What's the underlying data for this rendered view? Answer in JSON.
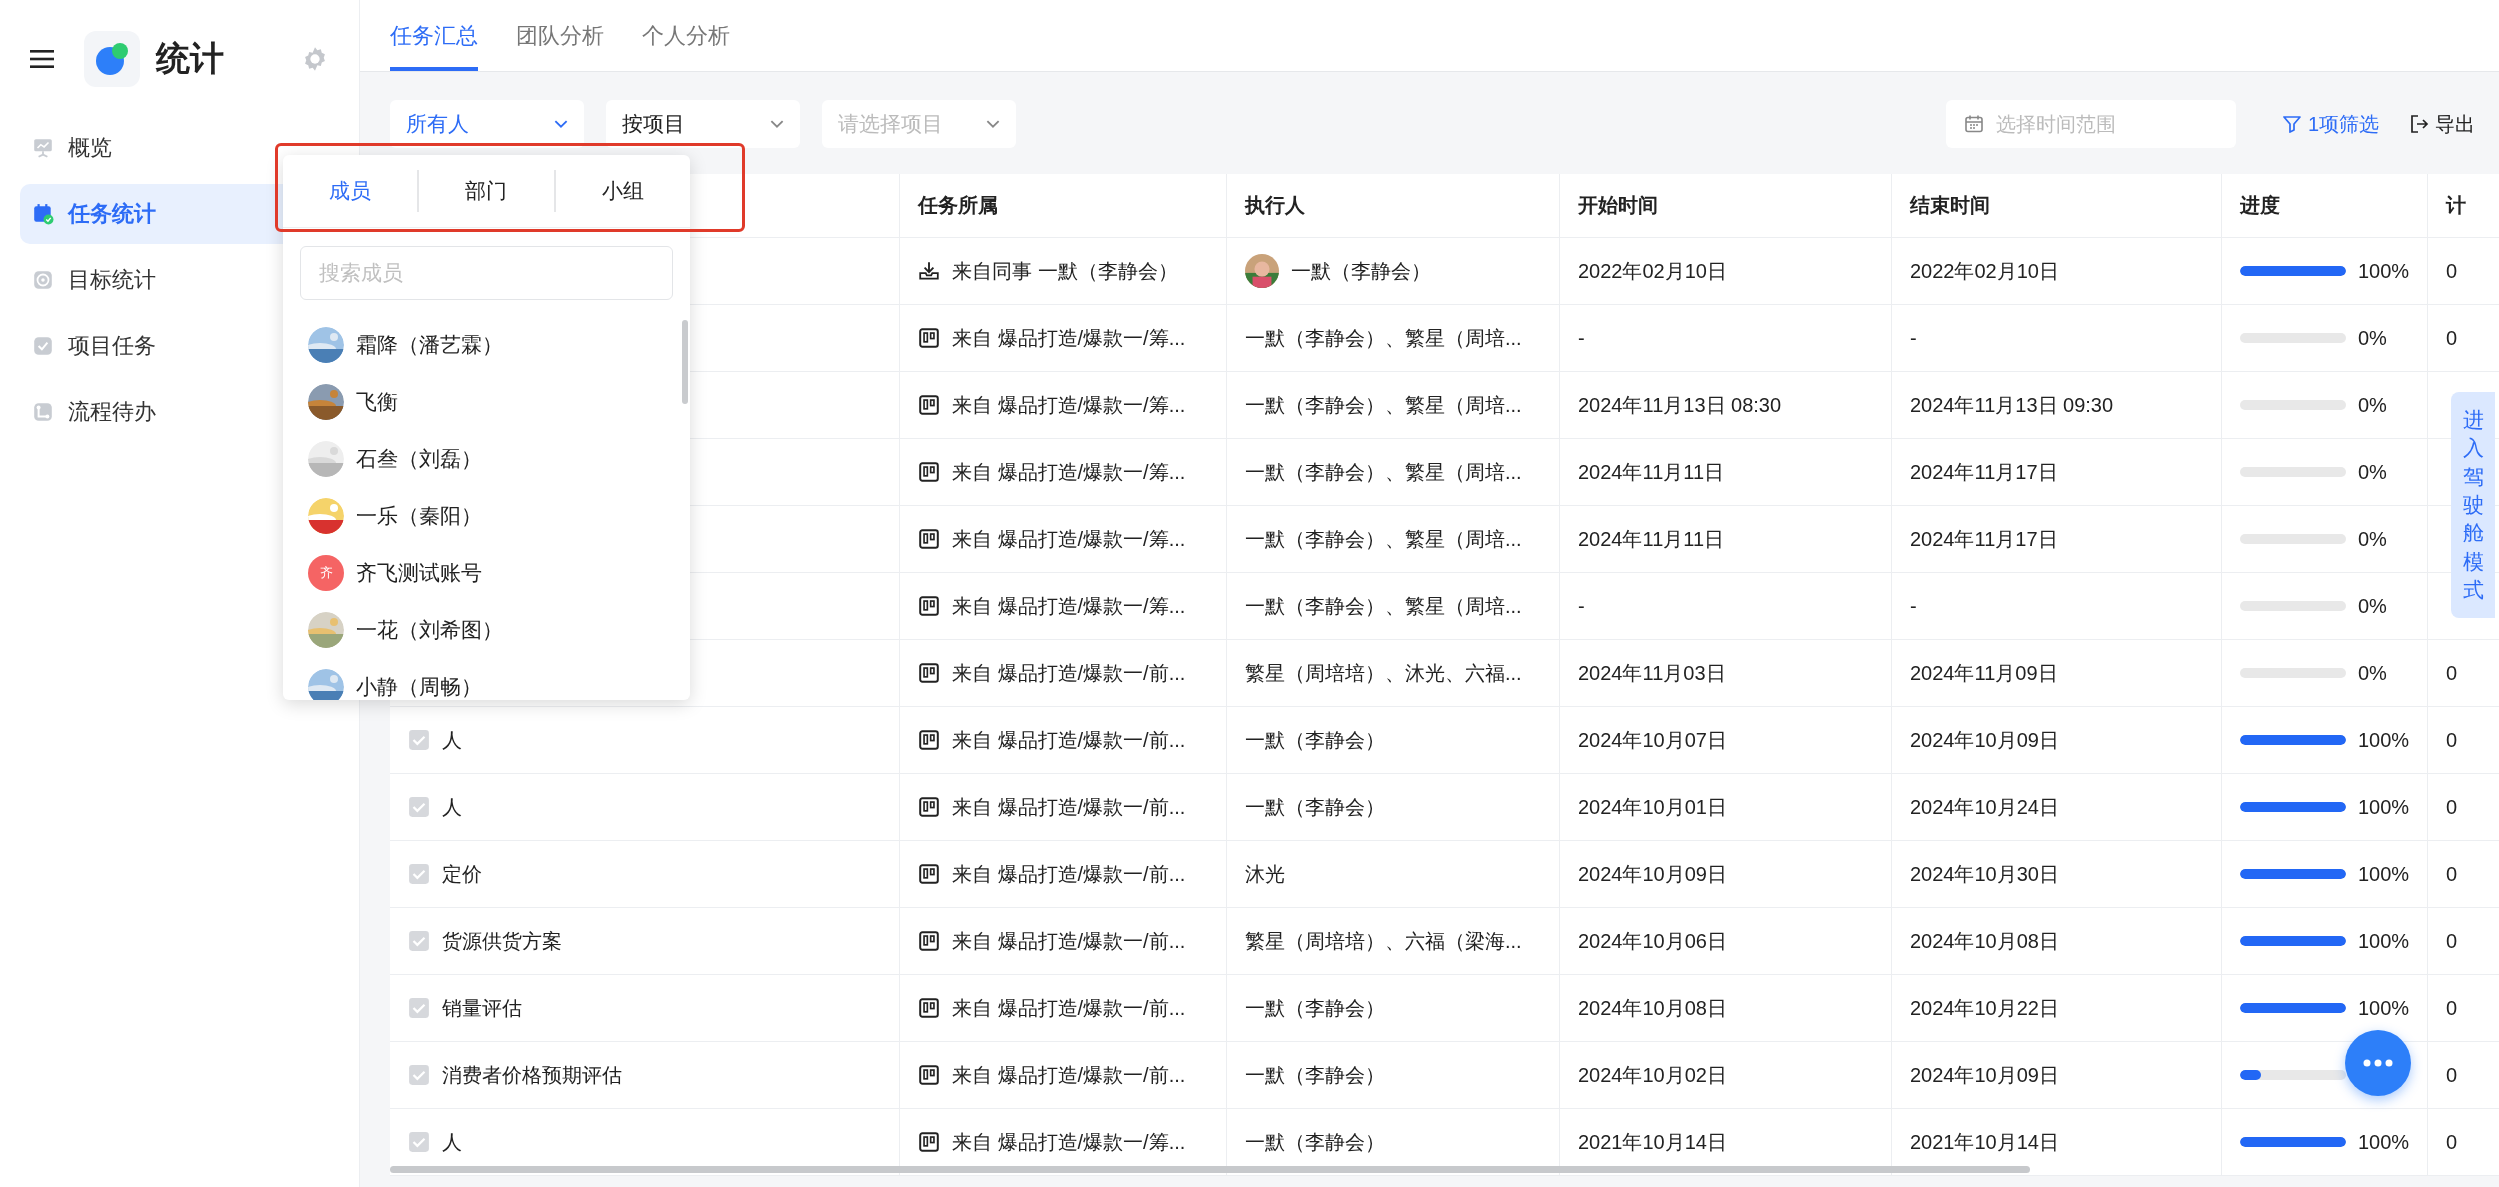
{
  "sidebar": {
    "title": "统计",
    "items": [
      {
        "label": "概览",
        "kind": "presentation",
        "selected": false
      },
      {
        "label": "任务统计",
        "kind": "calendar",
        "selected": true
      },
      {
        "label": "目标统计",
        "kind": "target",
        "selected": false
      },
      {
        "label": "项目任务",
        "kind": "check",
        "selected": false
      },
      {
        "label": "流程待办",
        "kind": "flow",
        "selected": false
      }
    ]
  },
  "tabs": [
    {
      "label": "任务汇总",
      "selected": true
    },
    {
      "label": "团队分析",
      "selected": false
    },
    {
      "label": "个人分析",
      "selected": false
    }
  ],
  "filters": {
    "owner": "所有人",
    "group_by": "按项目",
    "project_placeholder": "请选择项目",
    "date_placeholder": "选择时间范围",
    "filter_button": "1项筛选",
    "export_button": "导出"
  },
  "table": {
    "columns": [
      "任务所属",
      "执行人",
      "开始时间",
      "结束时间",
      "进度",
      "计"
    ],
    "rows": [
      {
        "kind": "colleague",
        "source": "来自同事 一默（李静会）",
        "assignee": "一默（李静会）",
        "assignee_photo": true,
        "start": "2022年02月10日",
        "end": "2022年02月10日",
        "level": 1,
        "progress": "100%",
        "column_7": "0"
      },
      {
        "kind": "project",
        "source": "来自 爆品打造/爆款一/筹...",
        "assignee": "一默（李静会）、繁星（周培...",
        "start": "-",
        "end": "-",
        "level": 0,
        "progress": "0%",
        "column_7": "0"
      },
      {
        "kind": "project",
        "source": "来自 爆品打造/爆款一/筹...",
        "assignee": "一默（李静会）、繁星（周培...",
        "start": "2024年11月13日 08:30",
        "end": "2024年11月13日 09:30",
        "level": 0,
        "progress": "0%"
      },
      {
        "kind": "project",
        "source": "来自 爆品打造/爆款一/筹...",
        "assignee": "一默（李静会）、繁星（周培...",
        "start": "2024年11月11日",
        "end": "2024年11月17日",
        "level": 0,
        "progress": "0%"
      },
      {
        "kind": "project",
        "source": "来自 爆品打造/爆款一/筹...",
        "assignee": "一默（李静会）、繁星（周培...",
        "start": "2024年11月11日",
        "end": "2024年11月17日",
        "level": 0,
        "progress": "0%"
      },
      {
        "kind": "project",
        "source": "来自 爆品打造/爆款一/筹...",
        "assignee": "一默（李静会）、繁星（周培...",
        "start": "-",
        "end": "-",
        "level": 0,
        "progress": "0%"
      },
      {
        "kind": "project",
        "source": "来自 爆品打造/爆款一/前...",
        "assignee": "繁星（周培培）、沐光、六福...",
        "start": "2024年11月03日",
        "end": "2024年11月09日",
        "level": 0,
        "progress": "0%",
        "column_7": "0"
      },
      {
        "name": "人",
        "kind": "project",
        "source": "来自 爆品打造/爆款一/前...",
        "assignee": "一默（李静会）",
        "start": "2024年10月07日",
        "end": "2024年10月09日",
        "level": 1,
        "progress": "100%",
        "column_7": "0"
      },
      {
        "name": "人",
        "kind": "project",
        "source": "来自 爆品打造/爆款一/前...",
        "assignee": "一默（李静会）",
        "start": "2024年10月01日",
        "end": "2024年10月24日",
        "level": 1,
        "progress": "100%",
        "column_7": "0"
      },
      {
        "name": "定价",
        "kind": "project",
        "source": "来自 爆品打造/爆款一/前...",
        "assignee": "沐光",
        "start": "2024年10月09日",
        "end": "2024年10月30日",
        "level": 1,
        "progress": "100%",
        "column_7": "0"
      },
      {
        "name": "货源供货方案",
        "kind": "project",
        "source": "来自 爆品打造/爆款一/前...",
        "assignee": "繁星（周培培）、六福（梁海...",
        "start": "2024年10月06日",
        "end": "2024年10月08日",
        "level": 1,
        "progress": "100%",
        "column_7": "0"
      },
      {
        "name": "销量评估",
        "kind": "project",
        "source": "来自 爆品打造/爆款一/前...",
        "assignee": "一默（李静会）",
        "start": "2024年10月08日",
        "end": "2024年10月22日",
        "level": 1,
        "progress": "100%",
        "column_7": "0"
      },
      {
        "name": "消费者价格预期评估",
        "kind": "project",
        "source": "来自 爆品打造/爆款一/前...",
        "assignee": "一默（李静会）",
        "start": "2024年10月02日",
        "end": "2024年10月09日",
        "level": 0.2,
        "column_7": "0"
      },
      {
        "name": "人",
        "kind": "project",
        "source": "来自 爆品打造/爆款一/筹...",
        "assignee": "一默（李静会）",
        "start": "2021年10月14日",
        "end": "2021年10月14日",
        "level": 1,
        "progress": "100%",
        "column_7": "0"
      }
    ]
  },
  "member_picker": {
    "tabs": [
      {
        "label": "成员",
        "selected": true
      },
      {
        "label": "部门",
        "selected": false
      },
      {
        "label": "小组",
        "selected": false
      }
    ],
    "search_placeholder": "搜索成员",
    "members": [
      {
        "name": "霜降（潘艺霖）"
      },
      {
        "name": "飞衡"
      },
      {
        "name": "石叁（刘磊）"
      },
      {
        "name": "一乐（秦阳）"
      },
      {
        "name": "齐飞测试账号",
        "kind": "initial",
        "initial": "齐",
        "color": "#f56464"
      },
      {
        "name": "一花（刘希图）"
      },
      {
        "name": "小静（周畅）"
      }
    ]
  },
  "side_tab": "进入驾驶舱模式"
}
